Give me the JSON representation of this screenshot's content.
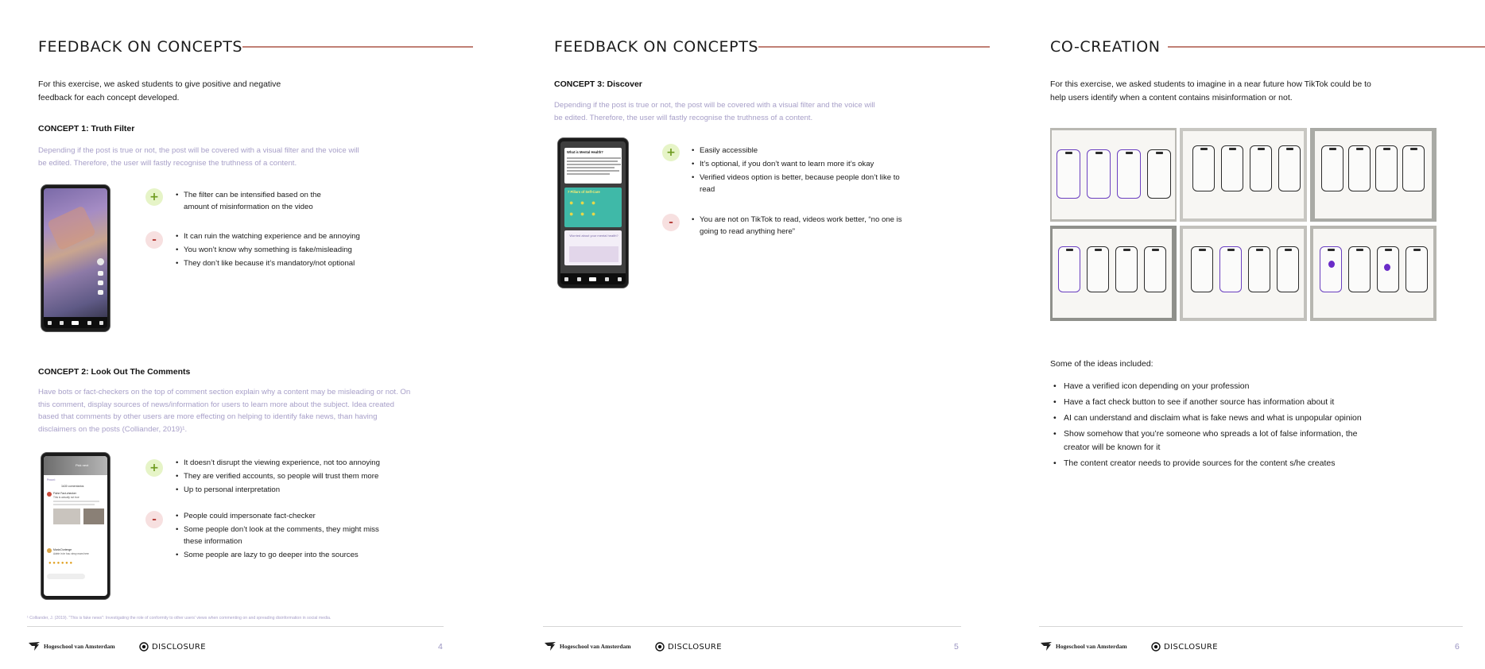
{
  "pages": [
    {
      "title": "FEEDBACK ON CONCEPTS",
      "intro": "For this exercise, we asked students to give positive and negative feedback for each concept developed.",
      "concept1": {
        "title": "CONCEPT 1: Truth Filter",
        "description": "Depending if the post is true or not, the post will be covered with a visual filter and the voice will be edited. Therefore, the user will fastly recognise the truthness of a content.",
        "positives": [
          "The filter can be intensified based on the amount of misinformation on the video"
        ],
        "negatives": [
          "It can ruin the watching experience and be annoying",
          "You won’t know why something is fake/misleading",
          "They don’t like because it’s mandatory/not optional"
        ]
      },
      "concept2": {
        "title": "CONCEPT 2: Look Out The Comments",
        "description": "Have bots or fact-checkers on the top of comment section explain why a content may be misleading or not. On this comment, display sources of news/information for users to learn more about the subject. Idea created based that comments by other users are more effecting on helping to identify fake news, than having disclaimers on the posts (Colliander, 2019)¹.",
        "positives": [
          "It doesn’t disrupt the viewing experience, not too annoying",
          "They are verified accounts, so people will trust them more",
          "Up to personal interpretation"
        ],
        "negatives": [
          "People could impersonate fact-checker",
          "Some people don’t look at the comments, they might miss these information",
          "Some people are lazy to go deeper into the sources"
        ]
      },
      "footnote": "¹ Colliander, J. (2019). \"This is fake news\": Investigating the role of conformity to other users' views when commenting on and spreading disinformation in social media.",
      "footer": {
        "hva": "Hogeschool van Amsterdam",
        "brand": "DISCLOSURE",
        "page_number": "4"
      }
    },
    {
      "title": "FEEDBACK ON CONCEPTS",
      "concept3": {
        "title": "CONCEPT 3: Discover",
        "description": "Depending if the post is true or not, the post will be covered with a visual filter and the voice will be edited. Therefore, the user will fastly recognise the truthness of a content.",
        "positives": [
          "Easily accessible",
          "It’s optional, if you don’t want to learn more it’s okay",
          "Verified videos option is better, because people don’t like to read"
        ],
        "negatives": [
          "You are not on TikTok to read, videos work better, “no one is going to read anything here”"
        ]
      },
      "footer": {
        "hva": "Hogeschool van Amsterdam",
        "brand": "DISCLOSURE",
        "page_number": "5"
      }
    },
    {
      "title": "CO-CREATION",
      "intro": "For this exercise, we asked students to imagine in a near future how TikTok could be to help users identify when a content contains misinformation or not.",
      "ideas_heading": "Some of the ideas included:",
      "ideas": [
        "Have a verified icon depending on your profession",
        "Have a fact check button to see if another source has information about it",
        "AI can understand and disclaim what is fake news and what is unpopular opinion",
        "Show somehow that you’re someone who spreads a lot of false information, the creator will be known for it",
        "The content creator needs to provide sources for the content s/he creates"
      ],
      "footer": {
        "hva": "Hogeschool van Amsterdam",
        "brand": "DISCLOSURE",
        "page_number": "6"
      }
    }
  ],
  "phone_mockups": {
    "comments_screen": {
      "header": "Pick next",
      "banner": "Prouni: ",
      "heading": "1k30 comentarios",
      "comments": [
        "Fiche Fact-checker",
        "This is actually not true",
        "Maria Dorienge",
        "Adele in te hou vinny mam here"
      ]
    },
    "discover_screen": {
      "question": "What is Mental Health?",
      "filters_title": "7 Pillars of Self-Care",
      "worried_text": "Worried about your mental health?"
    }
  },
  "colors": {
    "title_rule": "#c08075",
    "description_text": "#a79fc8",
    "plus_badge": "#e6f4c7",
    "minus_badge": "#f7e0e0",
    "page_number": "#9a94c2"
  },
  "icons": [
    "plus-icon",
    "minus-icon",
    "hva-logo-icon",
    "disclosure-logo-icon"
  ]
}
